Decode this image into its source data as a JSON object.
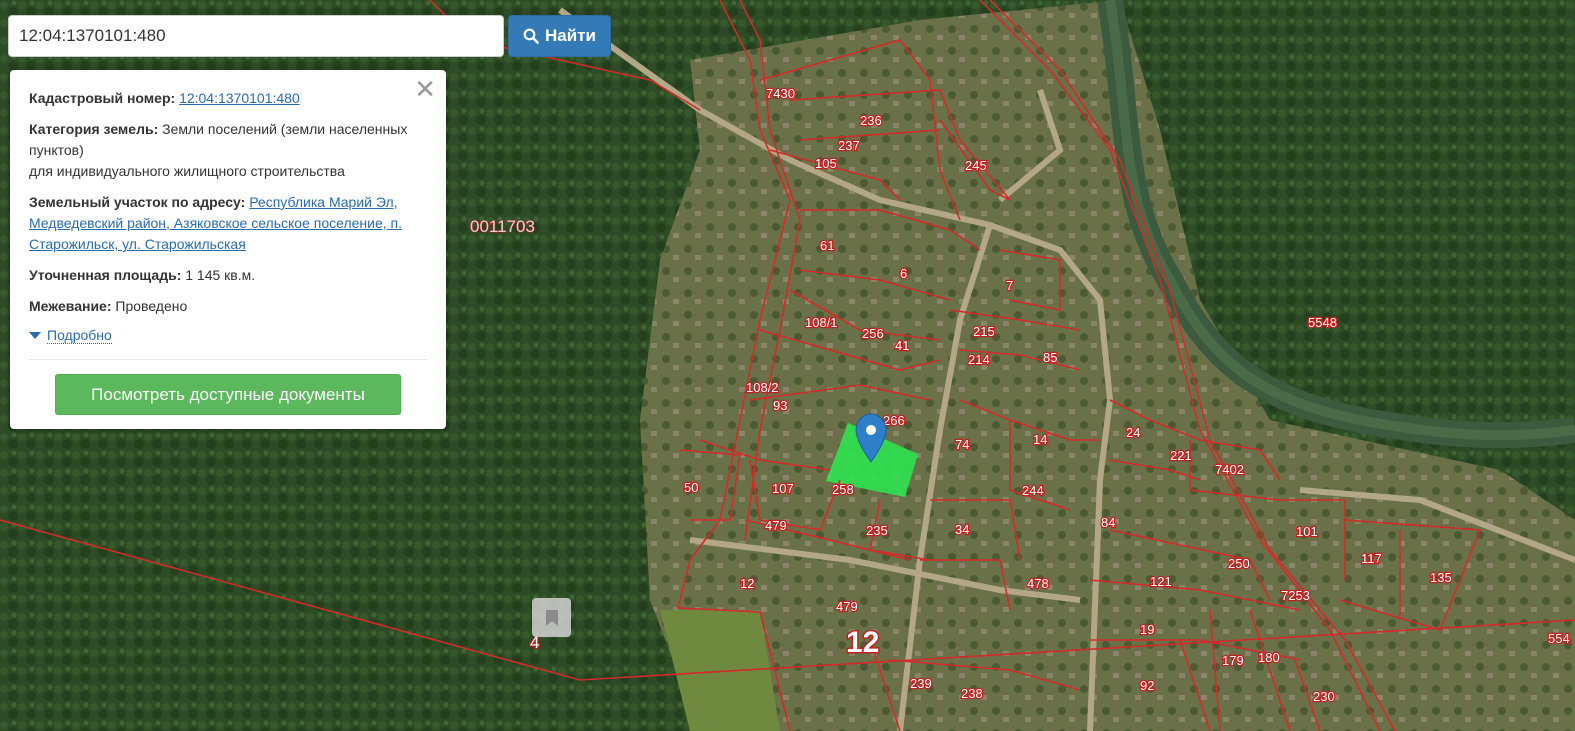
{
  "search": {
    "value": "12:04:1370101:480",
    "button_label": "Найти"
  },
  "info": {
    "cadastral_label": "Кадастровый номер:",
    "cadastral_value": "12:04:1370101:480",
    "category_label": "Категория земель:",
    "category_value": "Земли поселений (земли населенных пунктов)",
    "category_use": "для индивидуального жилищного строительства",
    "address_label": "Земельный участок по адресу:",
    "address_value": "Республика Марий Эл, Медведевский район, Азяковское сельское поселение, п. Старожильск, ул. Старожильская",
    "area_label": "Уточненная площадь:",
    "area_value": "1 145 кв.м.",
    "survey_label": "Межевание:",
    "survey_value": "Проведено",
    "more_label": "Подробно",
    "docs_button": "Посмотреть доступные документы",
    "close_icon": "close-icon"
  },
  "map": {
    "block_label": "0011703",
    "quarter_label": "12",
    "plot_labels": [
      "7430",
      "236",
      "237",
      "105",
      "245",
      "61",
      "6",
      "7",
      "108/1",
      "256",
      "41",
      "215",
      "214",
      "85",
      "108/2",
      "93",
      "266",
      "74",
      "14",
      "24",
      "221",
      "7402",
      "5548",
      "50",
      "107",
      "479",
      "258",
      "235",
      "34",
      "244",
      "84",
      "101",
      "250",
      "117",
      "135",
      "12",
      "479",
      "478",
      "121",
      "7253",
      "19",
      "179",
      "180",
      "92",
      "239",
      "238",
      "230",
      "554",
      "4"
    ]
  },
  "colors": {
    "parcel_line": "#d42a2a",
    "highlight": "#2fe34f",
    "marker": "#2c7fc8",
    "button_blue": "#337ab7",
    "button_green": "#5cb85c"
  }
}
